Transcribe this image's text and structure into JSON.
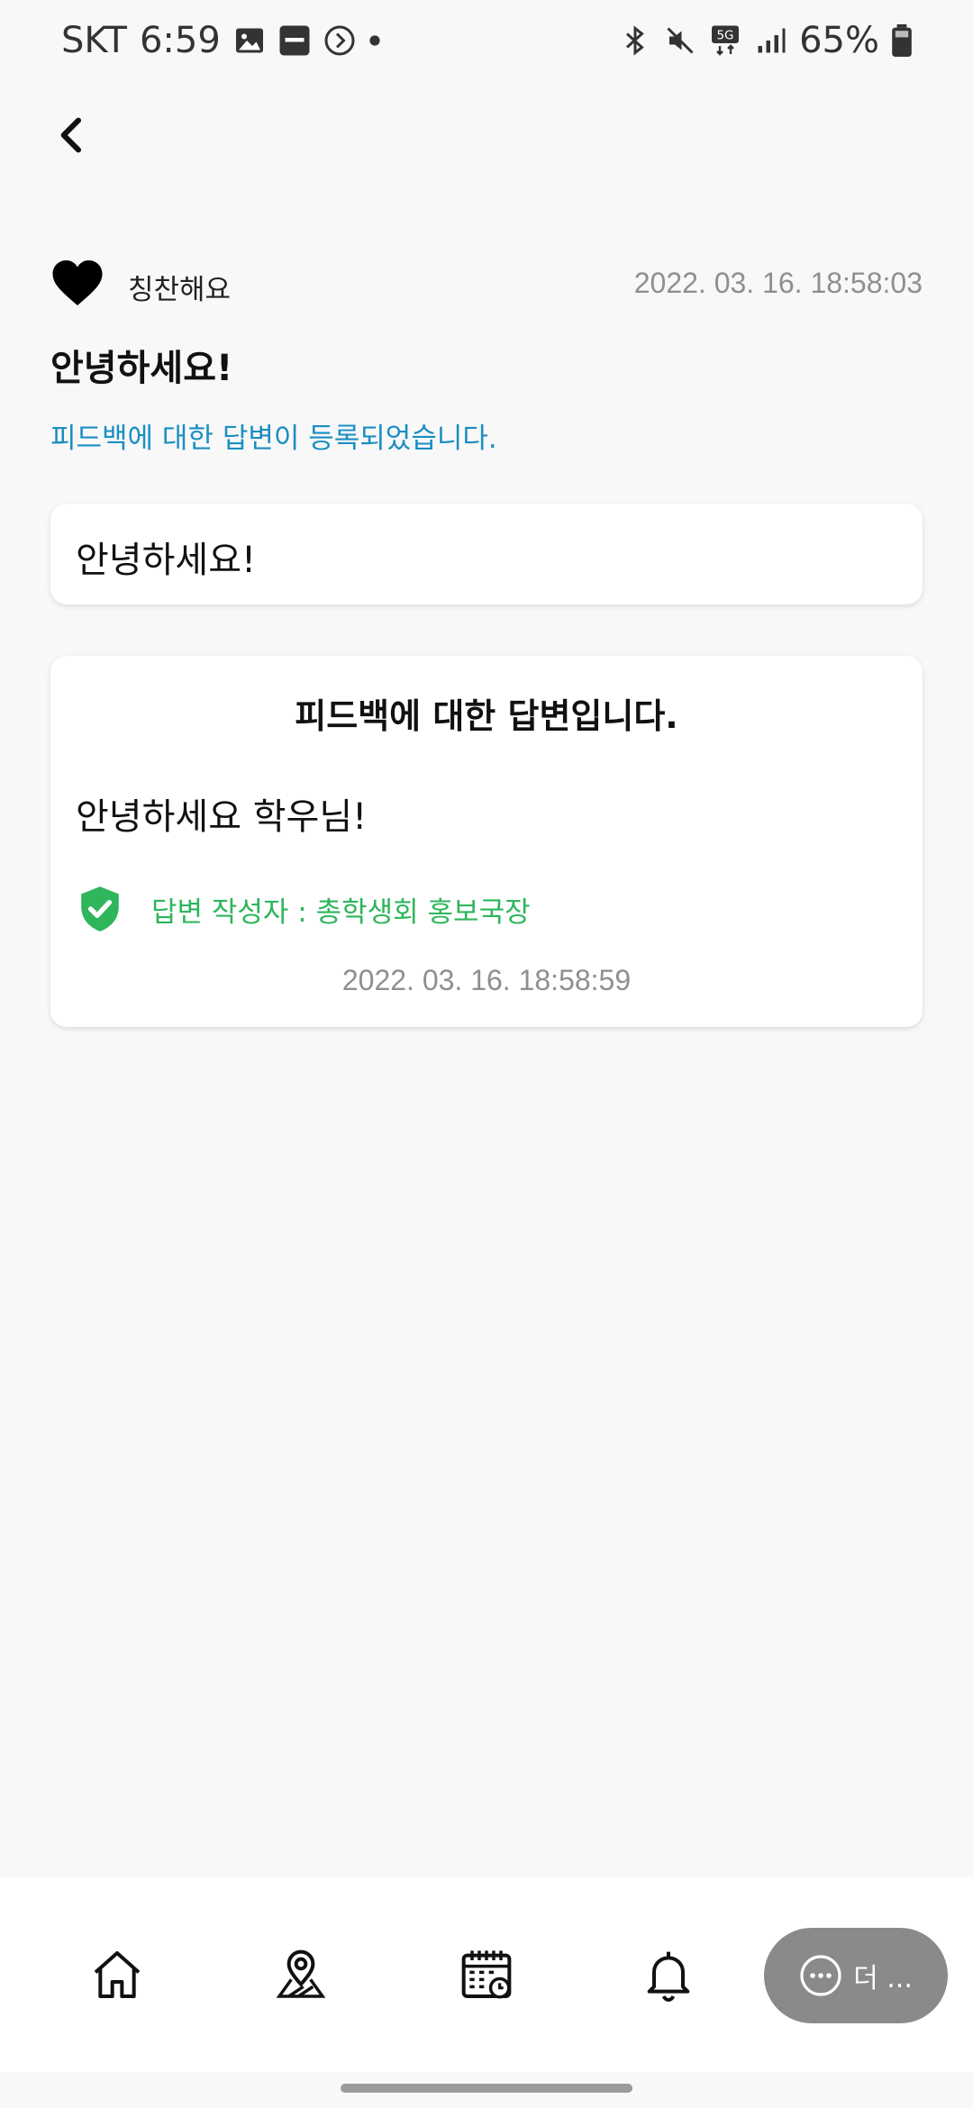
{
  "status_bar": {
    "carrier": "SKT",
    "time": "6:59",
    "battery": "65%",
    "network": "5G",
    "icons": [
      "gallery-icon",
      "kyobo-icon",
      "screen-record-icon",
      "dot-icon",
      "bluetooth-icon",
      "mute-icon",
      "5g-icon",
      "signal-icon",
      "battery-icon"
    ]
  },
  "post": {
    "category": "칭찬해요",
    "timestamp": "2022. 03. 16. 18:58:03",
    "title": "안녕하세요!",
    "notice": "피드백에 대한 답변이 등록되었습니다.",
    "content": "안녕하세요!"
  },
  "reply": {
    "heading": "피드백에 대한 답변입니다.",
    "message": "안녕하세요 학우님!",
    "author": "답변 작성자 : 총학생회 홍보국장",
    "timestamp": "2022. 03. 16. 18:58:59"
  },
  "bottom_nav": {
    "items": [
      "home-icon",
      "map-pin-icon",
      "calendar-icon",
      "bell-icon"
    ],
    "more_label": "더 ..."
  },
  "colors": {
    "notice": "#1a8ec2",
    "author": "#2fb55c",
    "more_button": "#8a8a8a"
  }
}
